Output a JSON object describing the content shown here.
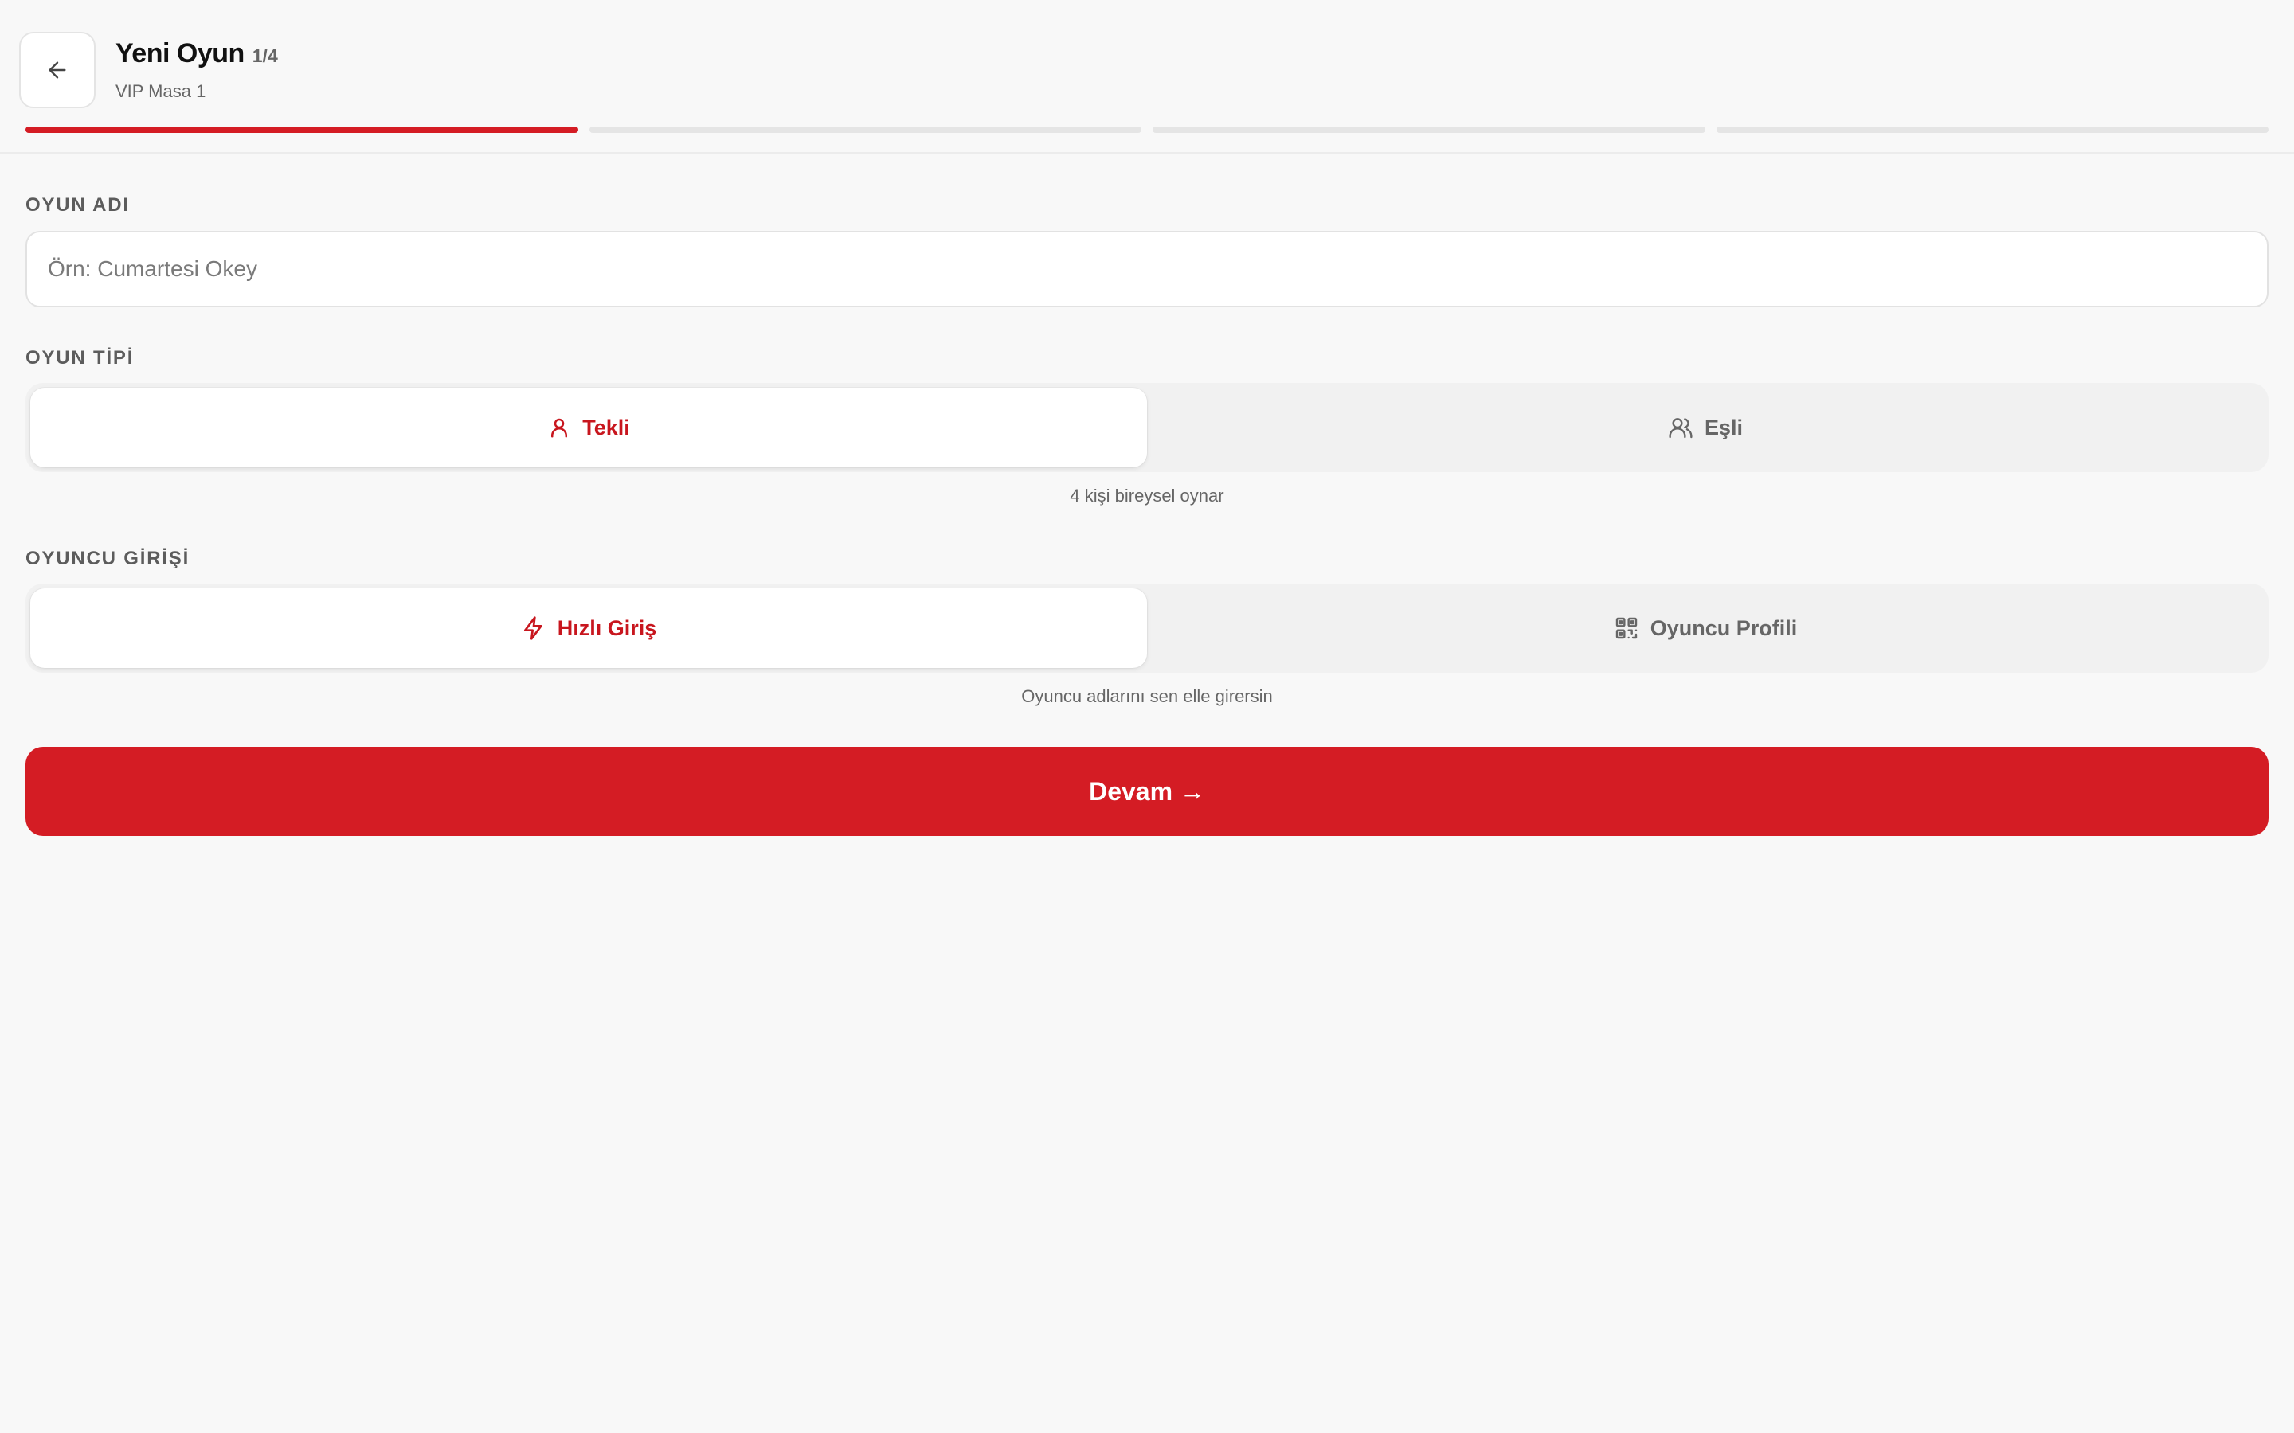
{
  "header": {
    "title": "Yeni Oyun",
    "step": "1/4",
    "subtitle": "VIP Masa 1",
    "back_icon": "arrow-left-icon",
    "progress": {
      "current_step": 1,
      "total_steps": 4
    }
  },
  "game_name": {
    "label": "OYUN ADI",
    "placeholder": "Örn: Cumartesi Okey",
    "value": ""
  },
  "game_type": {
    "label": "OYUN TİPİ",
    "options": [
      {
        "label": "Tekli",
        "icon": "user-icon",
        "selected": true
      },
      {
        "label": "Eşli",
        "icon": "users-icon",
        "selected": false
      }
    ],
    "hint": "4 kişi bireysel oynar"
  },
  "player_entry": {
    "label": "OYUNCU GİRİŞİ",
    "options": [
      {
        "label": "Hızlı Giriş",
        "icon": "lightning-icon",
        "selected": true
      },
      {
        "label": "Oyuncu Profili",
        "icon": "qr-code-icon",
        "selected": false
      }
    ],
    "hint": "Oyuncu adlarını sen elle girersin"
  },
  "continue_button": {
    "label": "Devam →"
  },
  "colors": {
    "accent": "#d41c24",
    "background": "#f8f8f8",
    "muted_text": "#666666"
  }
}
